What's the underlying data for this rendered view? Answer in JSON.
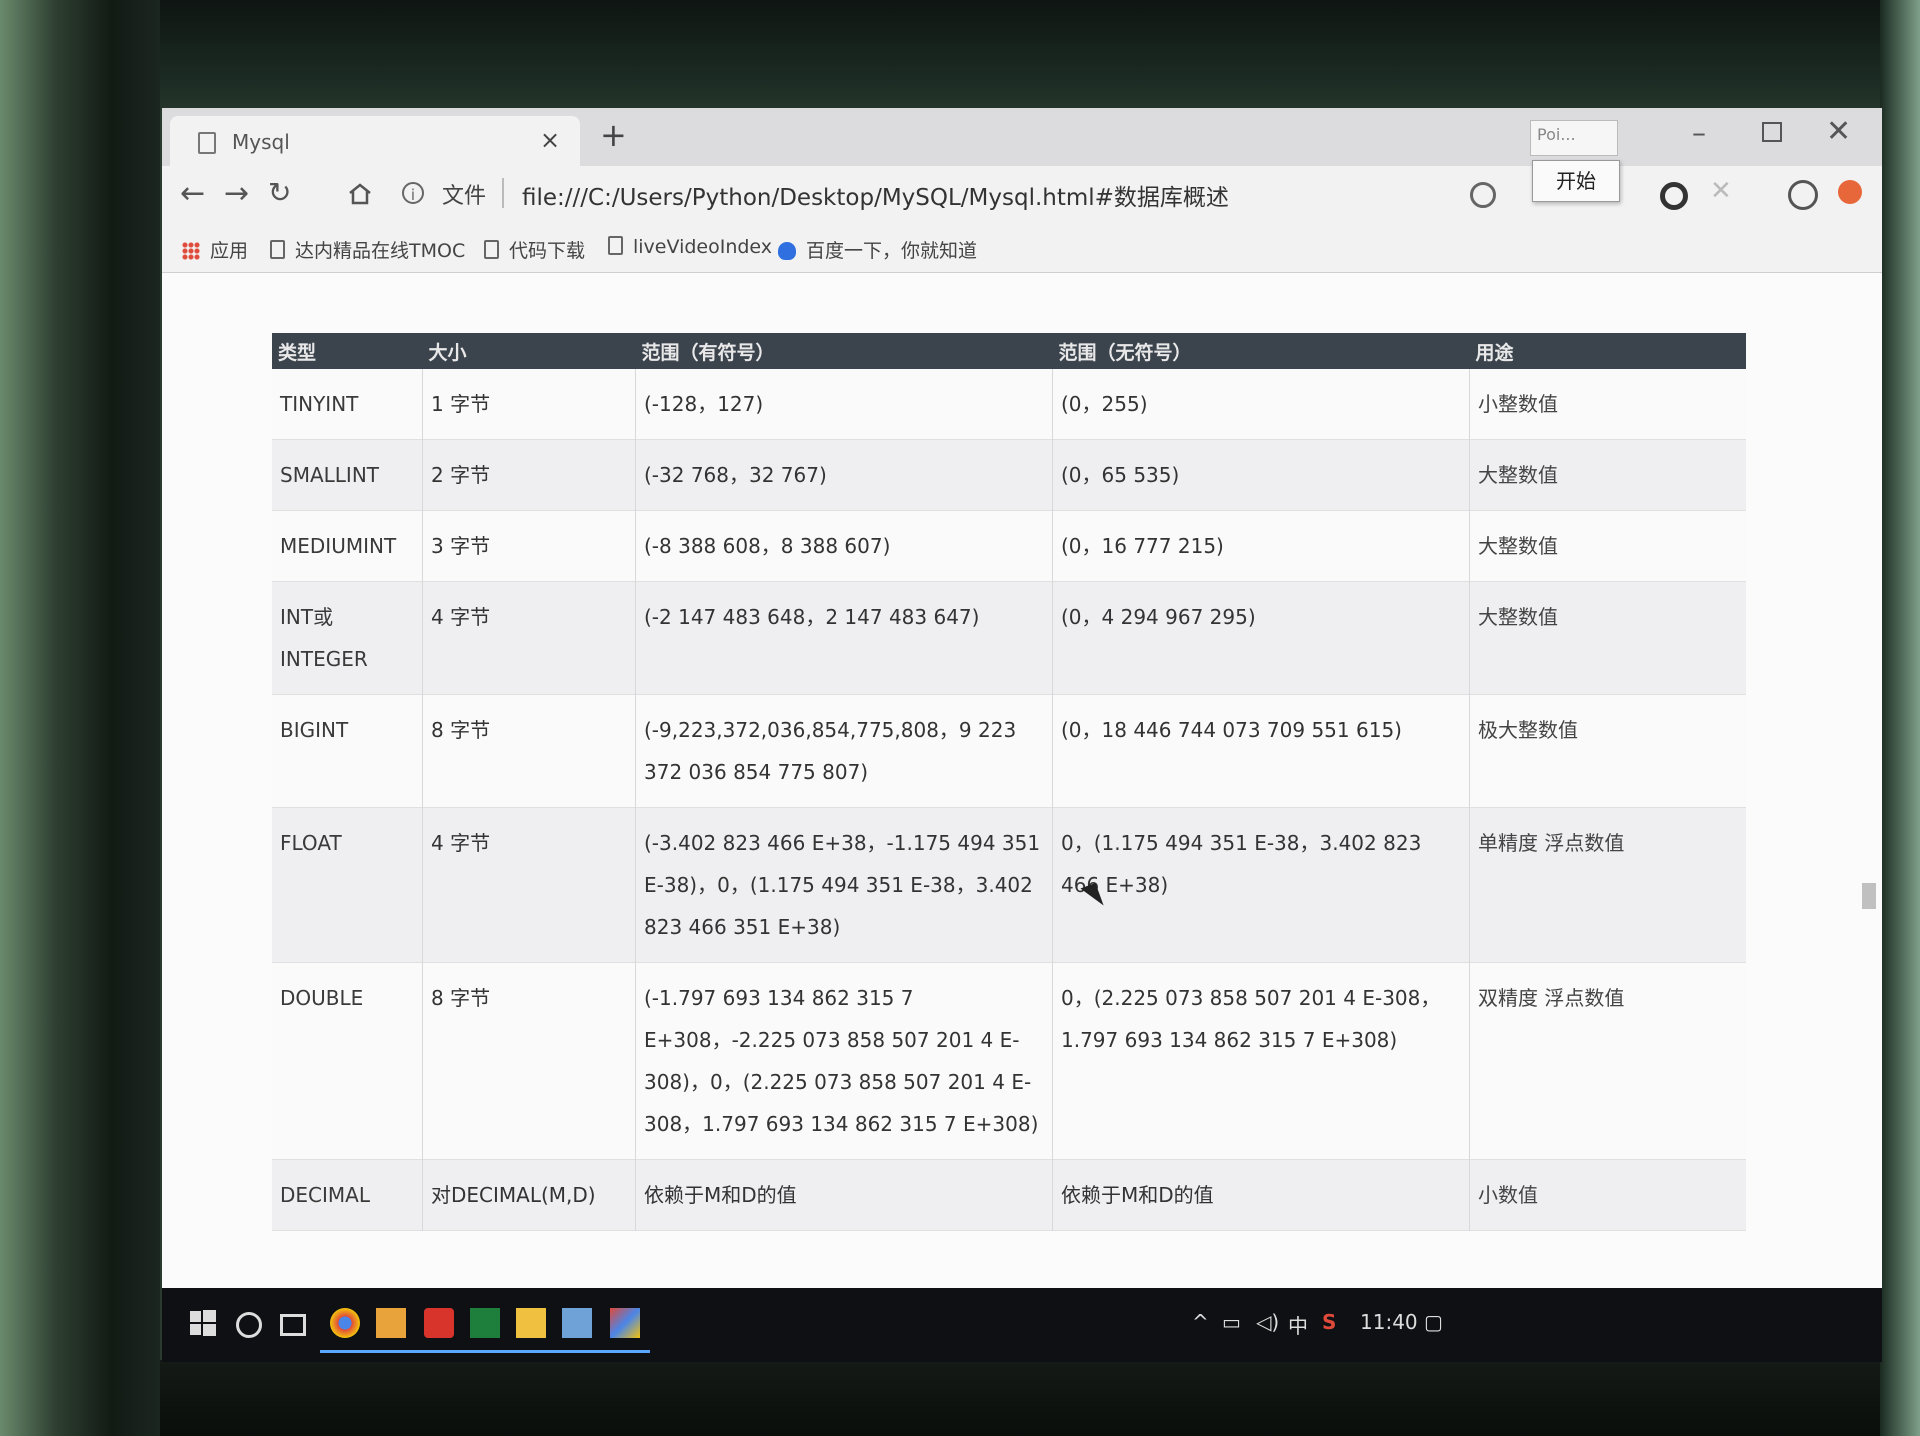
{
  "browser": {
    "tab_title": "Mysql",
    "tab_close": "×",
    "new_tab": "+",
    "mini_window_label": "Poi...",
    "tooltip_start": "开始",
    "address": {
      "info": "i",
      "file_label": "文件",
      "url": "file:///C:/Users/Python/Desktop/MySQL/Mysql.html#数据库概述"
    },
    "bookmarks": [
      {
        "label": "应用",
        "icon": "apps-grid-icon"
      },
      {
        "label": "达内精品在线TMOC",
        "icon": "page-icon"
      },
      {
        "label": "代码下载",
        "icon": "page-icon"
      },
      {
        "label": "liveVideoIndex",
        "icon": "page-icon"
      },
      {
        "label": "百度一下，你就知道",
        "icon": "baidu-paw-icon"
      }
    ]
  },
  "table": {
    "headers": [
      "类型",
      "大小",
      "范围（有符号）",
      "范围（无符号）",
      "用途"
    ],
    "rows": [
      {
        "type": "TINYINT",
        "size": "1 字节",
        "signed": "(-128，127)",
        "unsigned": "(0，255)",
        "use": "小整数值"
      },
      {
        "type": "SMALLINT",
        "size": "2 字节",
        "signed": "(-32 768，32 767)",
        "unsigned": "(0，65 535)",
        "use": "大整数值"
      },
      {
        "type": "MEDIUMINT",
        "size": "3 字节",
        "signed": "(-8 388 608，8 388 607)",
        "unsigned": "(0，16 777 215)",
        "use": "大整数值"
      },
      {
        "type": "INT或 INTEGER",
        "size": "4 字节",
        "signed": "(-2 147 483 648，2 147 483 647)",
        "unsigned": "(0，4 294 967 295)",
        "use": "大整数值"
      },
      {
        "type": "BIGINT",
        "size": "8 字节",
        "signed": "(-9,223,372,036,854,775,808，9 223 372 036 854 775 807)",
        "unsigned": "(0，18 446 744 073 709 551 615)",
        "use": "极大整数值"
      },
      {
        "type": "FLOAT",
        "size": "4 字节",
        "signed": "(-3.402 823 466 E+38，-1.175 494 351 E-38)，0，(1.175 494 351 E-38，3.402 823 466 351 E+38)",
        "unsigned": "0，(1.175 494 351 E-38，3.402 823 466 E+38)",
        "use": "单精度 浮点数值"
      },
      {
        "type": "DOUBLE",
        "size": "8 字节",
        "signed": "(-1.797 693 134 862 315 7 E+308，-2.225 073 858 507 201 4 E-308)，0，(2.225 073 858 507 201 4 E-308，1.797 693 134 862 315 7 E+308)",
        "unsigned": "0，(2.225 073 858 507 201 4 E-308，1.797 693 134 862 315 7 E+308)",
        "use": "双精度 浮点数值"
      },
      {
        "type": "DECIMAL",
        "size": "对DECIMAL(M,D)",
        "signed": "依赖于M和D的值",
        "unsigned": "依赖于M和D的值",
        "use": "小数值"
      }
    ]
  },
  "taskbar": {
    "ime": "中",
    "clock": "11:40"
  }
}
